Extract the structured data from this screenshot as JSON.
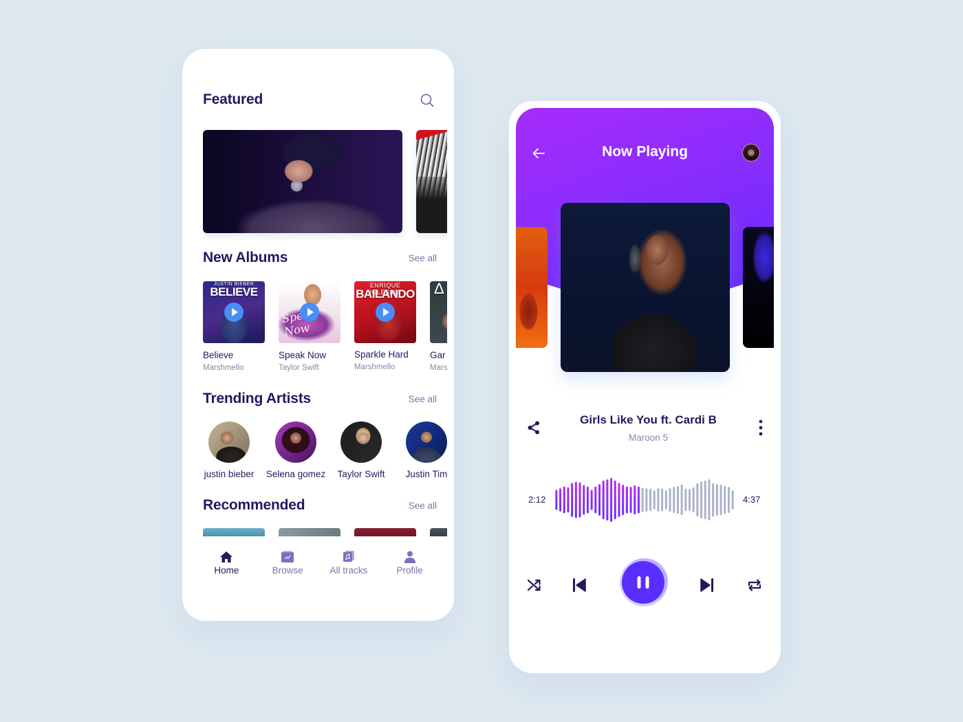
{
  "home": {
    "featured": {
      "title": "Featured",
      "search_icon": "search-icon",
      "cards": [
        {
          "subject": "singer with microphone and cap"
        },
        {
          "subject": "blonde singer in black and white"
        }
      ]
    },
    "new_albums": {
      "title": "New Albums",
      "see_all": "See all",
      "items": [
        {
          "title": "Believe",
          "artist": "Marshmello",
          "cover_text": "BELIEVE",
          "cover_top": "JUSTIN BIEBER",
          "has_play": true
        },
        {
          "title": "Speak Now",
          "artist": "Taylor Swift",
          "cover_text": "Speak Now",
          "has_play": true
        },
        {
          "title": "Sparkle Hard",
          "artist": "Marshmello",
          "cover_text": "BAILANDO",
          "cover_top": "ENRIQUE IGLESIAS",
          "has_play": true
        },
        {
          "title": "Gar",
          "artist": "Mars",
          "cover_text": "Δ",
          "has_play": false
        }
      ]
    },
    "trending_artists": {
      "title": "Trending Artists",
      "see_all": "See all",
      "items": [
        {
          "name": "justin bieber"
        },
        {
          "name": "Selena gomez"
        },
        {
          "name": "Taylor Swift"
        },
        {
          "name": "Justin Tim"
        }
      ]
    },
    "recommended": {
      "title": "Recommended",
      "see_all": "See all",
      "items_count": 4
    },
    "nav": [
      {
        "label": "Home",
        "icon": "home-icon",
        "active": true
      },
      {
        "label": "Browse",
        "icon": "browse-icon",
        "active": false
      },
      {
        "label": "All tracks",
        "icon": "music-note-icon",
        "active": false
      },
      {
        "label": "Profile",
        "icon": "user-icon",
        "active": false
      }
    ]
  },
  "player": {
    "title": "Now Playing",
    "back_icon": "arrow-left-icon",
    "song": {
      "title": "Girls Like You ft. Cardi B",
      "artist": "Maroon 5"
    },
    "time_current": "2:12",
    "time_total": "4:37",
    "progress_fraction": 0.48,
    "waveform_levels": [
      0.33,
      0.42,
      0.52,
      0.47,
      0.72,
      0.78,
      0.75,
      0.6,
      0.52,
      0.33,
      0.52,
      0.65,
      0.85,
      0.92,
      1.0,
      0.85,
      0.72,
      0.62,
      0.52,
      0.5,
      0.58,
      0.52,
      0.45,
      0.42,
      0.4,
      0.3,
      0.42,
      0.4,
      0.3,
      0.43,
      0.5,
      0.55,
      0.62,
      0.4,
      0.38,
      0.47,
      0.7,
      0.8,
      0.85,
      0.92,
      0.7,
      0.65,
      0.62,
      0.55,
      0.5,
      0.3
    ],
    "colors": {
      "accent": "#5a2dff",
      "played_top": "#b02cf6",
      "played_bottom": "#6a2eff",
      "unplayed": "#a9b2c8",
      "header_start": "#c22cf8",
      "header_end": "#5b2bff",
      "text_dark": "#24185e"
    },
    "controls": [
      "shuffle-icon",
      "skip-previous-icon",
      "pause-icon",
      "skip-next-icon",
      "repeat-icon"
    ]
  }
}
